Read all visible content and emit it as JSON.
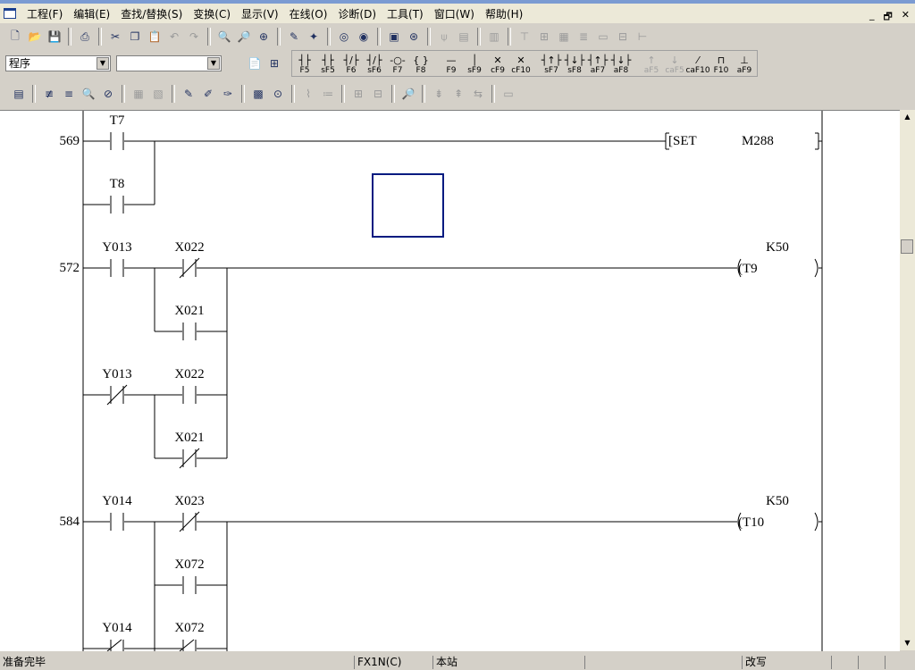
{
  "menu": [
    "工程(F)",
    "编辑(E)",
    "查找/替换(S)",
    "变换(C)",
    "显示(V)",
    "在线(O)",
    "诊断(D)",
    "工具(T)",
    "窗口(W)",
    "帮助(H)"
  ],
  "window_controls": [
    "_",
    "🗗",
    "✕"
  ],
  "toolbar2": {
    "program_combo": "程序",
    "second_combo": "",
    "fkeys": [
      "F5",
      "sF5",
      "F6",
      "sF6",
      "F7",
      "F8",
      "F9",
      "sF9",
      "cF9",
      "cF10",
      "sF7",
      "sF8",
      "aF7",
      "aF8",
      "aF5",
      "caF5",
      "caF10",
      "F10",
      "aF9"
    ]
  },
  "ladder": {
    "rung_numbers": [
      "569",
      "572",
      "584"
    ],
    "contacts": [
      "T7",
      "T8",
      "Y013",
      "X022",
      "X021",
      "Y013",
      "X022",
      "X021",
      "Y014",
      "X023",
      "X072",
      "Y014",
      "X072"
    ],
    "instructions": {
      "set_open": "[SET",
      "set_device": "M288",
      "set_close": "]",
      "coil_t9_label": "K50",
      "coil_t9": "(T9",
      "coil_t9_close": ")",
      "coil_t10_label": "K50",
      "coil_t10": "(T10",
      "coil_t10_close": ")"
    }
  },
  "status": {
    "ready": "准备完毕",
    "plc": "FX1N(C)",
    "station": "本站",
    "mode": "改写"
  }
}
